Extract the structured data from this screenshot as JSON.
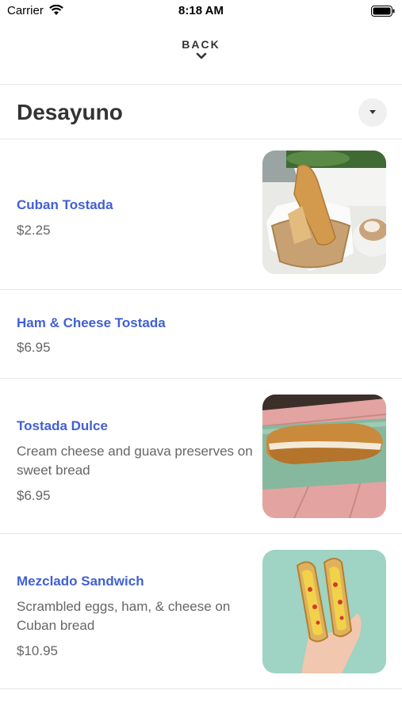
{
  "status_bar": {
    "carrier": "Carrier",
    "time": "8:18 AM"
  },
  "header": {
    "back_label": "BACK",
    "back_icon": "chevron-down-icon"
  },
  "category": {
    "title": "Desayuno",
    "toggle_icon": "caret-down-icon"
  },
  "items": [
    {
      "name": "Cuban Tostada",
      "description": "",
      "price": "$2.25",
      "has_photo": true
    },
    {
      "name": "Ham & Cheese Tostada",
      "description": "",
      "price": "$6.95",
      "has_photo": false
    },
    {
      "name": "Tostada Dulce",
      "description": "Cream cheese and guava preserves on sweet bread",
      "price": "$6.95",
      "has_photo": true
    },
    {
      "name": "Mezclado Sandwich",
      "description": "Scrambled eggs, ham, & cheese on Cuban bread",
      "price": "$10.95",
      "has_photo": true
    }
  ],
  "colors": {
    "item_name": "#4160d2",
    "text_secondary": "#666666",
    "divider": "#e6e6e6"
  }
}
